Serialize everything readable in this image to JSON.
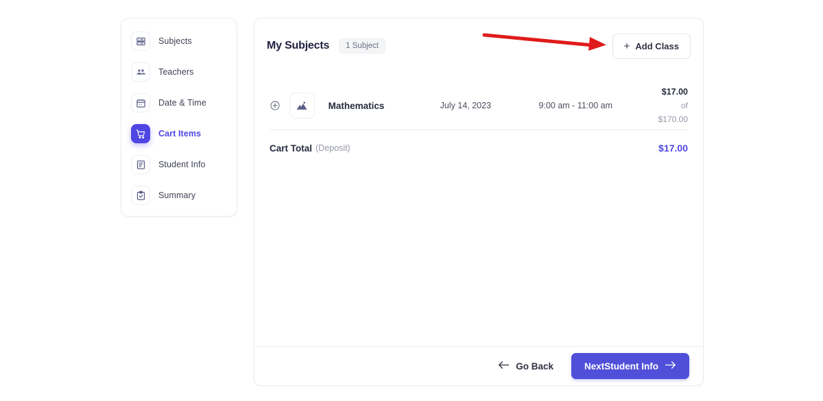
{
  "sidebar": {
    "items": [
      {
        "label": "Subjects",
        "icon": "server-list-icon",
        "active": false
      },
      {
        "label": "Teachers",
        "icon": "users-icon",
        "active": false
      },
      {
        "label": "Date & Time",
        "icon": "calendar-icon",
        "active": false
      },
      {
        "label": "Cart Items",
        "icon": "shopping-cart-icon",
        "active": true
      },
      {
        "label": "Student Info",
        "icon": "document-text-icon",
        "active": false
      },
      {
        "label": "Summary",
        "icon": "clipboard-check-icon",
        "active": false
      }
    ]
  },
  "main": {
    "title": "My Subjects",
    "badge": "1 Subject",
    "add_class_label": "Add Class",
    "add_class_icon": "plus-icon",
    "expand_icon": "plus-circle-icon",
    "subject_icon": "mountain-image-icon",
    "rows": [
      {
        "name": "Mathematics",
        "date": "July 14, 2023",
        "time": "9:00 am - 11:00 am",
        "price": "$17.00",
        "price_of": "of $170.00"
      }
    ],
    "total_label": "Cart Total",
    "total_note": "(Deposit)",
    "total_value": "$17.00"
  },
  "footer": {
    "back_label": "Go Back",
    "back_icon": "arrow-left-icon",
    "next_label": "NextStudent Info",
    "next_icon": "arrow-right-icon"
  },
  "annotation": {
    "type": "red-arrow",
    "color": "#e01b1b",
    "points_to": "Add Class"
  },
  "colors": {
    "accent": "#4f46e5",
    "button": "#4f4fd9",
    "text": "#272a3d",
    "muted": "#9498a8",
    "annotation": "#e01b1b"
  }
}
